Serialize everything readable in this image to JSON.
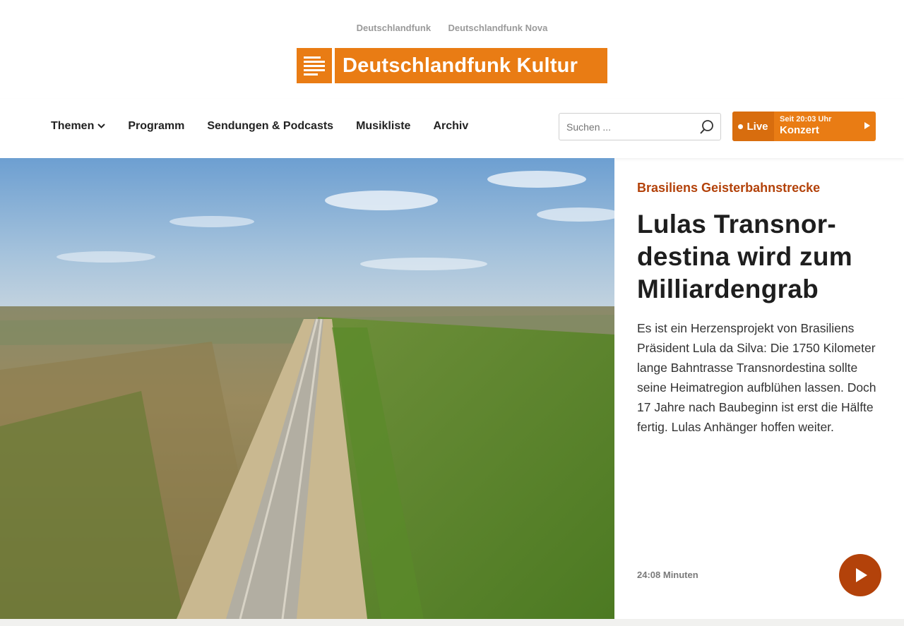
{
  "sister_sites": [
    "Deutschlandfunk",
    "Deutschlandfunk Nova"
  ],
  "logo": {
    "text": "Deutschlandfunk Kultur",
    "color": "#e97c14"
  },
  "nav": {
    "items": [
      {
        "label": "Themen",
        "has_dropdown": true
      },
      {
        "label": "Programm"
      },
      {
        "label": "Sendungen & Podcasts"
      },
      {
        "label": "Musikliste"
      },
      {
        "label": "Archiv"
      }
    ]
  },
  "search": {
    "placeholder": "Suchen ..."
  },
  "live": {
    "tag": "Live",
    "since": "Seit 20:03 Uhr",
    "show": "Konzert"
  },
  "hero": {
    "kicker": "Brasiliens Geisterbahnstrecke",
    "headline": "Lulas Transnor-destina wird zum Milliardengrab",
    "teaser": "Es ist ein Herzensprojekt von Brasiliens Präsident Lula da Silva: Die 1750 Kilometer lange Bahntrasse Transnordestina sollte seine Heimatregion aufblühen lassen. Doch 17 Jahre nach Baubeginn ist erst die Hälfte fertig. Lulas Anhänger hoffen weiter.",
    "duration": "24:08 Minuten",
    "accent_color": "#b3420a"
  }
}
